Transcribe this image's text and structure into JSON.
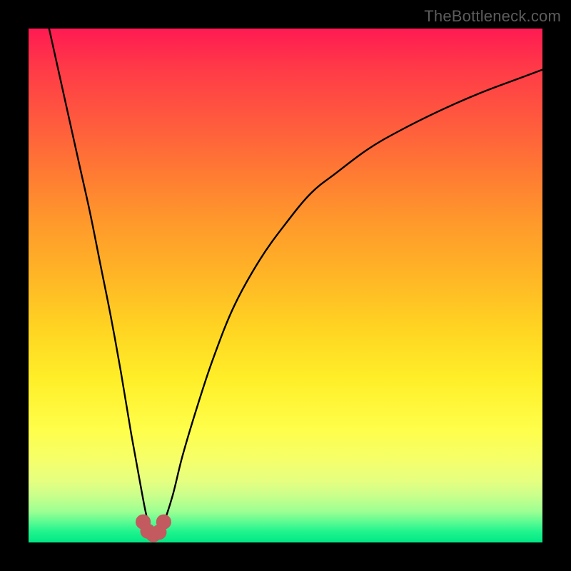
{
  "watermark": "TheBottleneck.com",
  "colors": {
    "page_bg": "#000000",
    "curve_stroke": "#000000",
    "marker_fill": "#c35a5f",
    "marker_stroke": "#c35a5f"
  },
  "chart_data": {
    "type": "line",
    "title": "",
    "xlabel": "",
    "ylabel": "",
    "xlim": [
      0,
      100
    ],
    "ylim": [
      0,
      100
    ],
    "grid": false,
    "legend": false,
    "series": [
      {
        "name": "bottleneck-curve",
        "x": [
          4,
          6,
          8,
          10,
          12,
          14,
          16,
          18,
          20,
          22,
          23,
          24,
          25,
          26,
          28,
          30,
          33,
          36,
          40,
          45,
          50,
          55,
          60,
          66,
          72,
          80,
          88,
          96,
          100
        ],
        "y": [
          100,
          91,
          82,
          73,
          64,
          54,
          44,
          33,
          21,
          10,
          5,
          2,
          1.5,
          3,
          9,
          17,
          27,
          36,
          46,
          55,
          62,
          68,
          72,
          76.5,
          80,
          84,
          87.5,
          90.5,
          92
        ]
      }
    ],
    "markers": [
      {
        "x": 22.3,
        "y": 4.0,
        "r": 1.4
      },
      {
        "x": 23.2,
        "y": 2.2,
        "r": 1.4
      },
      {
        "x": 24.3,
        "y": 1.5,
        "r": 1.4
      },
      {
        "x": 25.4,
        "y": 2.0,
        "r": 1.4
      },
      {
        "x": 26.3,
        "y": 4.0,
        "r": 1.4
      }
    ],
    "notch_center_x": 24.3
  }
}
